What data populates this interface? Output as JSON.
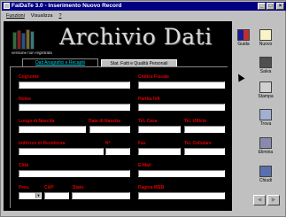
{
  "window": {
    "title": "FaiDaTe 3.0 - Inserimento Nuovo Record",
    "controls": {
      "minimize": "_",
      "maximize": "□",
      "close": "×"
    }
  },
  "menu": [
    "Funzioni",
    "Visualizza",
    "?"
  ],
  "header": {
    "title": "Archivio Dati",
    "version_note": "versione non registrata"
  },
  "tabs": [
    {
      "label": "Dati Anagrafici e Recapiti",
      "active": true
    },
    {
      "label": "Stat. Fatti e Qualità Personali",
      "active": false
    }
  ],
  "form": {
    "cognome": "Cognome",
    "nome": "Nome",
    "luogo_nascita": "Luogo di Nascita",
    "data_nascita": "Data di Nascita",
    "indirizzo": "Indirizzo di Residenza",
    "numero": "N°",
    "citta": "Città",
    "prov": "Prov.",
    "cap": "CAP",
    "stato": "Stato",
    "codice_fiscale": "Codice Fiscale",
    "partita_iva": "Partita IVA",
    "tel_casa": "Tel. Casa",
    "tel_ufficio": "Tel. Ufficio",
    "fax": "Fax",
    "tel_cellulare": "Tel. Cellulare",
    "email": "E-Mail",
    "pagina_web": "Pagina WEB"
  },
  "toolbar": [
    {
      "label": "Guida",
      "icon": "book-icon"
    },
    {
      "label": "Nuovo",
      "icon": "new-icon"
    },
    {
      "label": "Salva",
      "icon": "save-icon"
    },
    {
      "label": "Stampa",
      "icon": "print-icon"
    },
    {
      "label": "Trova",
      "icon": "find-icon"
    },
    {
      "label": "Elimina",
      "icon": "trash-icon"
    },
    {
      "label": "Chiudi",
      "icon": "close-door-icon"
    }
  ],
  "nav": {
    "prev": "◀",
    "next": "▶"
  },
  "colors": {
    "label_red": "#e00000",
    "tab_cyan": "#00d0e0",
    "titlebar": "#000080"
  }
}
